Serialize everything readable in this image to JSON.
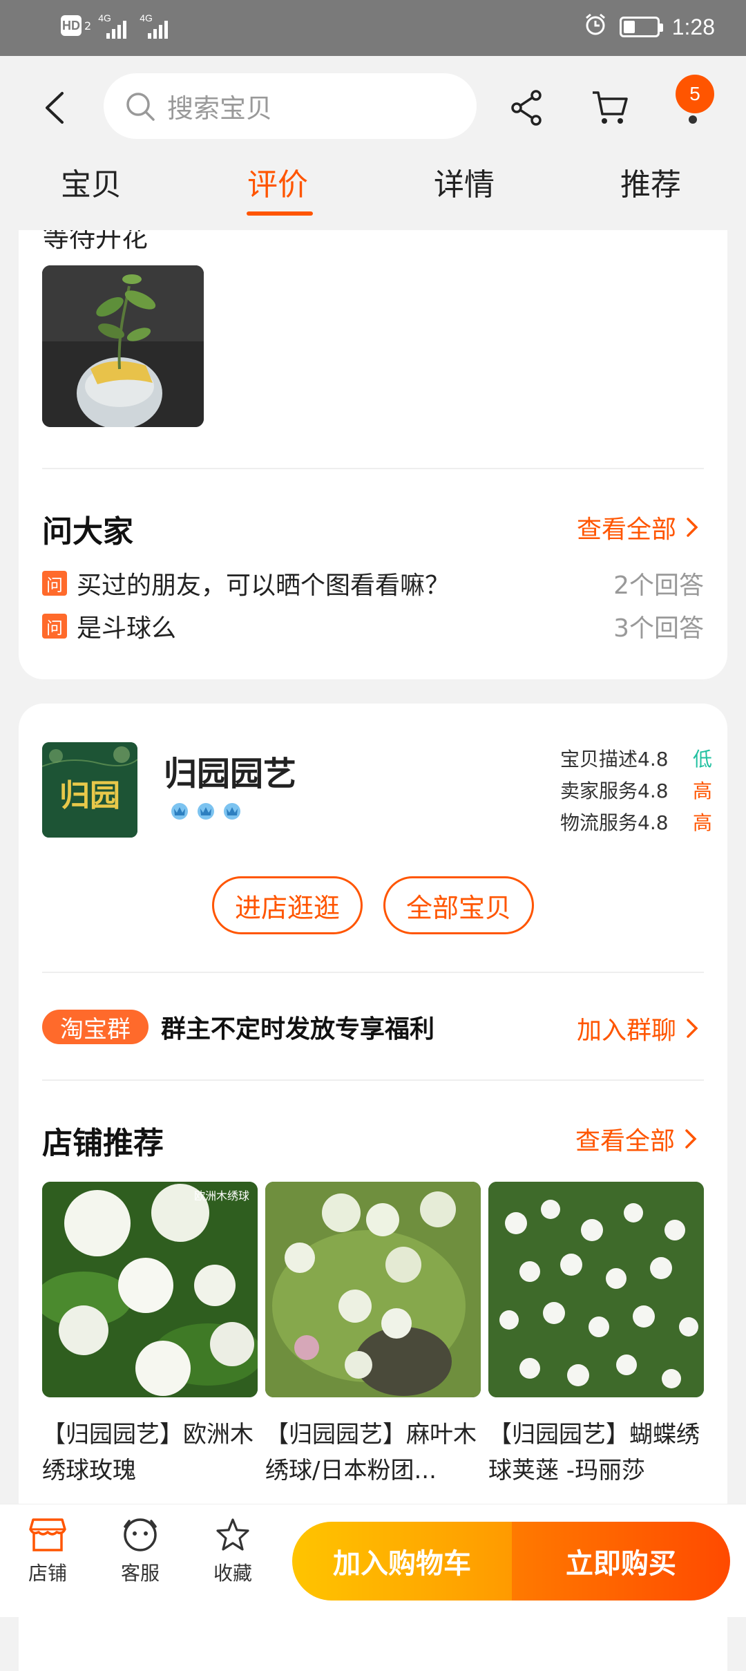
{
  "status_bar": {
    "hd": "HD",
    "hd_sub": "2",
    "net1": "4G",
    "net2": "4G",
    "time": "1:28",
    "battery_level": 0.35
  },
  "header": {
    "search_placeholder": "搜索宝贝",
    "cart_count": "5",
    "tabs": [
      {
        "label": "宝贝",
        "active": false
      },
      {
        "label": "评价",
        "active": true
      },
      {
        "label": "详情",
        "active": false
      },
      {
        "label": "推荐",
        "active": false
      }
    ]
  },
  "review": {
    "cut_text": "等待开花"
  },
  "qa": {
    "title": "问大家",
    "view_all": "查看全部",
    "icon_label": "问",
    "items": [
      {
        "question": "买过的朋友，可以晒个图看看嘛？",
        "answers": "2个回答"
      },
      {
        "question": "是斗球么",
        "answers": "3个回答"
      }
    ]
  },
  "shop": {
    "name": "归园园艺",
    "logo_text": "归园",
    "ratings": [
      {
        "label": "宝贝描述4.8",
        "level": "低"
      },
      {
        "label": "卖家服务4.8",
        "level": "高"
      },
      {
        "label": "物流服务4.8",
        "level": "高"
      }
    ],
    "enter_shop": "进店逛逛",
    "all_items": "全部宝贝",
    "group_tag": "淘宝群",
    "group_text": "群主不定时发放专享福利",
    "join_group": "加入群聊",
    "recommend_title": "店铺推荐",
    "recommend_view_all": "查看全部",
    "products": [
      {
        "name": "【归园园艺】欧洲木绣球玫瑰",
        "img_label": "欧洲木绣球"
      },
      {
        "name": "【归园园艺】麻叶木绣球/日本粉团..."
      },
      {
        "name": "【归园园艺】蝴蝶绣球荚蒾 -玛丽莎"
      }
    ]
  },
  "bottom_bar": {
    "shop": "店铺",
    "service": "客服",
    "favorite": "收藏",
    "add_cart": "加入购物车",
    "buy_now": "立即购买"
  }
}
